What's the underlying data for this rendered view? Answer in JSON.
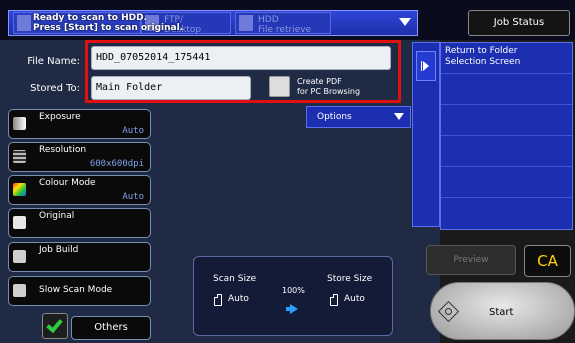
{
  "header": {
    "status_message_line1": "Ready to scan to HDD.",
    "status_message_line2": "Press [Start] to scan original.",
    "tabs": [
      {
        "label": "FTP/",
        "label2": "Desktop"
      },
      {
        "label": "HDD",
        "label2": "File retrieve"
      }
    ],
    "job_status_label": "Job Status"
  },
  "form": {
    "file_name_label": "File Name:",
    "file_name_value": "HDD_07052014_175441",
    "stored_to_label": "Stored To:",
    "stored_to_value": "Main Folder",
    "create_pdf_line1": "Create PDF",
    "create_pdf_line2": "for PC Browsing",
    "options_label": "Options"
  },
  "settings": [
    {
      "title": "Exposure",
      "value": "Auto"
    },
    {
      "title": "Resolution",
      "value": "600x600dpi"
    },
    {
      "title": "Colour Mode",
      "value": "Auto"
    },
    {
      "title": "Original",
      "value": ""
    },
    {
      "title": "Job Build",
      "value": ""
    },
    {
      "title": "Slow Scan Mode",
      "value": ""
    }
  ],
  "others_label": "Others",
  "scan_panel": {
    "scan_size_label": "Scan Size",
    "scan_size_value": "Auto",
    "store_size_label": "Store Size",
    "store_size_value": "Auto",
    "ratio": "100%"
  },
  "side_list": {
    "items": [
      {
        "line1": "Return to Folder",
        "line2": "Selection Screen"
      }
    ]
  },
  "preview_label": "Preview",
  "ca_label": "CA",
  "start_label": "Start",
  "colors": {
    "accent_blue": "#1c2fb0",
    "highlight_red": "#e01010",
    "ca_yellow": "#ffd400",
    "arrow_blue": "#27a0ff"
  }
}
